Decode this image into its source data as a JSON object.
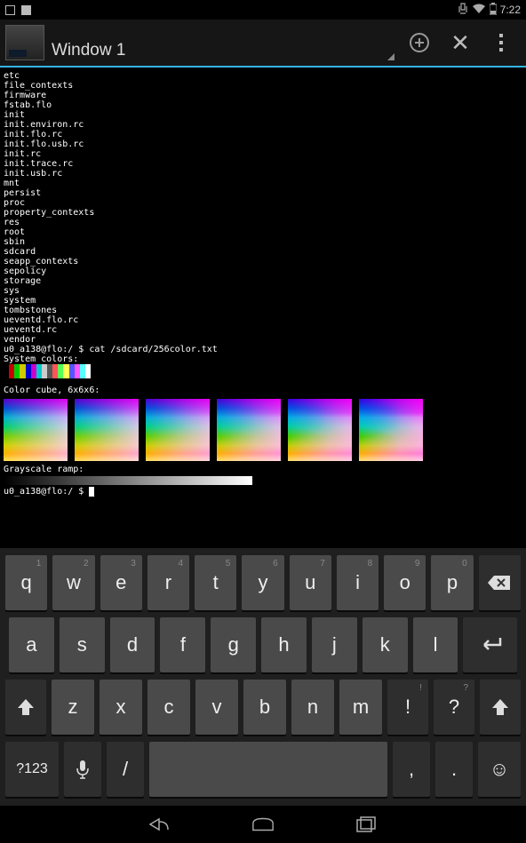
{
  "status": {
    "time": "7:22",
    "vibrate": "🔇",
    "wifi": "📶",
    "battery": "🔋"
  },
  "actionbar": {
    "window_title": "Window 1"
  },
  "terminal": {
    "lines": [
      "etc",
      "file_contexts",
      "firmware",
      "fstab.flo",
      "init",
      "init.environ.rc",
      "init.flo.rc",
      "init.flo.usb.rc",
      "init.rc",
      "init.trace.rc",
      "init.usb.rc",
      "mnt",
      "persist",
      "proc",
      "property_contexts",
      "res",
      "root",
      "sbin",
      "sdcard",
      "seapp_contexts",
      "sepolicy",
      "storage",
      "sys",
      "system",
      "tombstones",
      "ueventd.flo.rc",
      "ueventd.rc",
      "vendor"
    ],
    "prompt1": "u0_a138@flo:/ $ cat /sdcard/256color.txt",
    "label_syscolors": "System colors:",
    "label_cube": "Color cube, 6x6x6:",
    "label_gray": "Grayscale ramp:",
    "prompt2": "u0_a138@flo:/ $ "
  },
  "syscolors": [
    "#000",
    "#c00",
    "#0c0",
    "#cc0",
    "#00c",
    "#c0c",
    "#0cc",
    "#ccc",
    "#555",
    "#f55",
    "#5f5",
    "#ff5",
    "#55f",
    "#f5f",
    "#5ff",
    "#fff"
  ],
  "keyboard": {
    "row1": [
      {
        "k": "q",
        "s": "1"
      },
      {
        "k": "w",
        "s": "2"
      },
      {
        "k": "e",
        "s": "3"
      },
      {
        "k": "r",
        "s": "4"
      },
      {
        "k": "t",
        "s": "5"
      },
      {
        "k": "y",
        "s": "6"
      },
      {
        "k": "u",
        "s": "7"
      },
      {
        "k": "i",
        "s": "8"
      },
      {
        "k": "o",
        "s": "9"
      },
      {
        "k": "p",
        "s": "0"
      }
    ],
    "row2": [
      "a",
      "s",
      "d",
      "f",
      "g",
      "h",
      "j",
      "k",
      "l"
    ],
    "row3": [
      "z",
      "x",
      "c",
      "v",
      "b",
      "n",
      "m",
      {
        "k": "!",
        "s": "!"
      },
      {
        "k": "?",
        "s": "?"
      }
    ],
    "symkey": "?123",
    "slash": "/",
    "comma": ",",
    "period": "."
  }
}
